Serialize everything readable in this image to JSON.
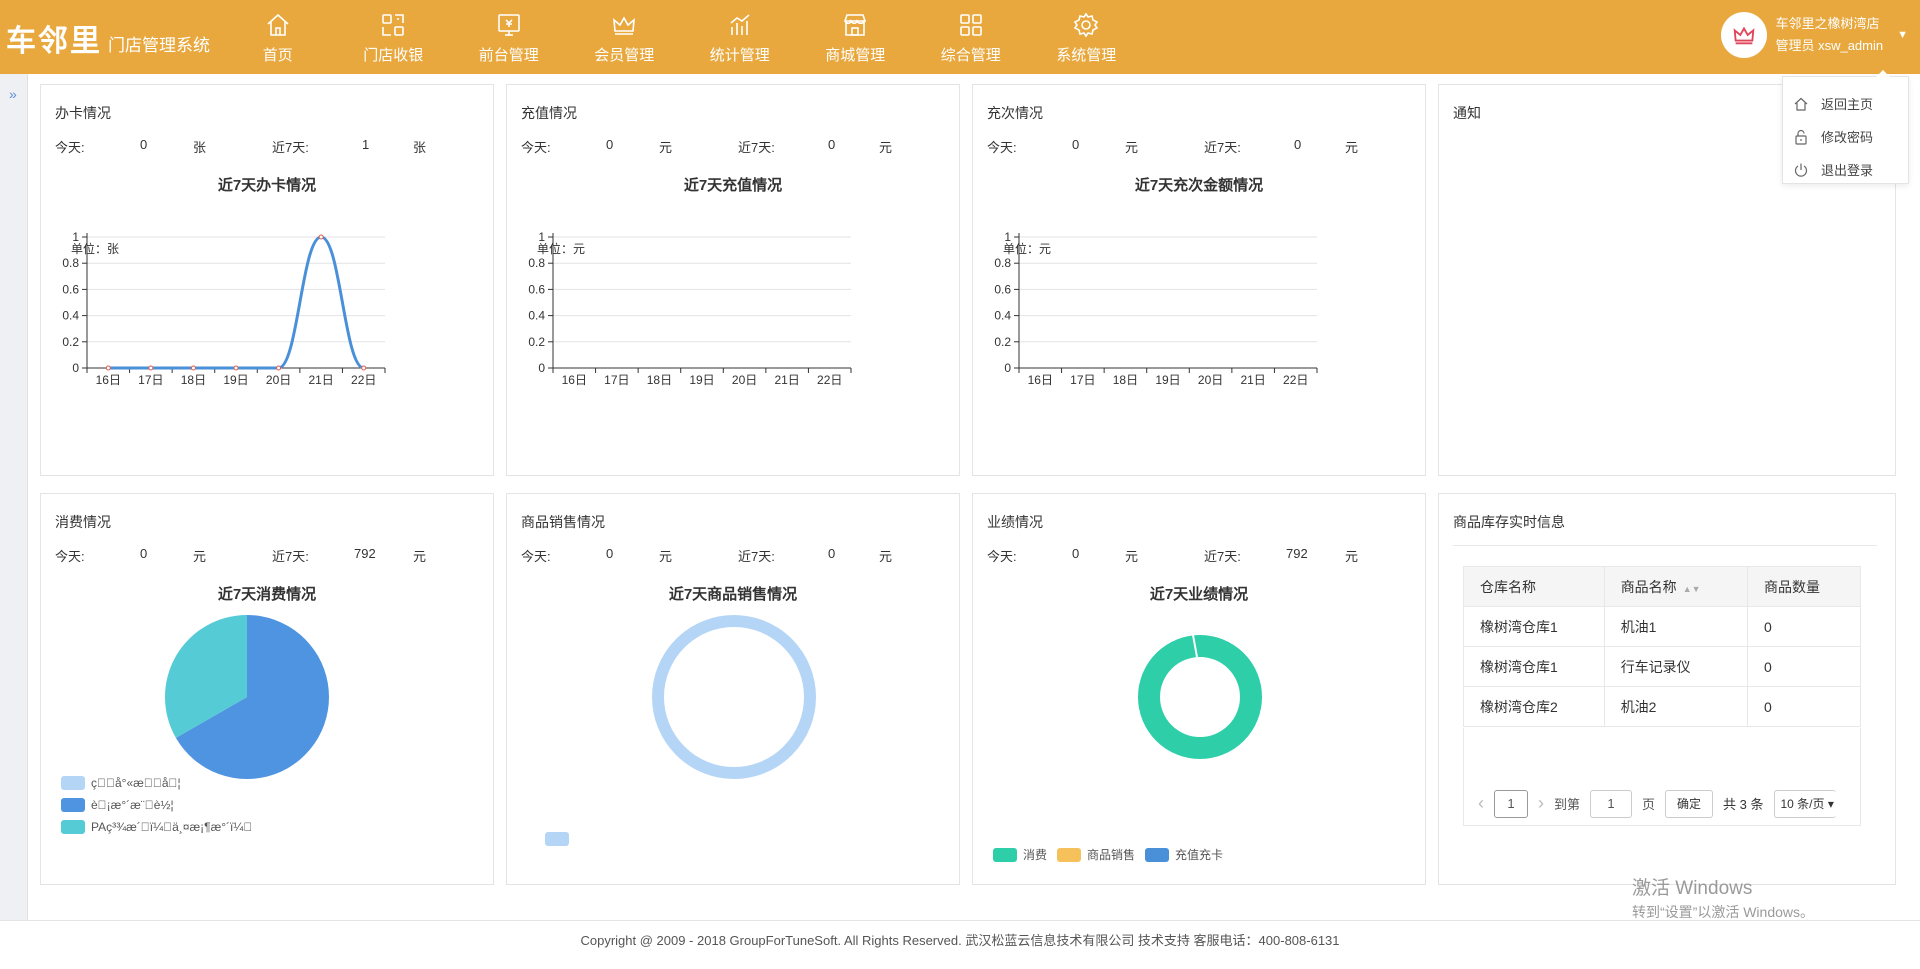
{
  "brand": {
    "name": "车邻里",
    "subtitle": "门店管理系统"
  },
  "nav": [
    {
      "label": "首页",
      "icon": "home-icon"
    },
    {
      "label": "门店收银",
      "icon": "cashier-icon"
    },
    {
      "label": "前台管理",
      "icon": "front-desk-icon"
    },
    {
      "label": "会员管理",
      "icon": "crown-icon"
    },
    {
      "label": "统计管理",
      "icon": "stats-icon"
    },
    {
      "label": "商城管理",
      "icon": "shop-icon"
    },
    {
      "label": "综合管理",
      "icon": "grid-icon"
    },
    {
      "label": "系统管理",
      "icon": "gear-icon"
    }
  ],
  "user": {
    "store": "车邻里之橡树湾店",
    "role": "管理员",
    "account": "xsw_admin"
  },
  "dropdown": [
    {
      "label": "返回主页",
      "icon": "home-icon"
    },
    {
      "label": "修改密码",
      "icon": "lock-icon"
    },
    {
      "label": "退出登录",
      "icon": "power-icon"
    }
  ],
  "colors": {
    "header": "#e8a83e",
    "line": "#4a90d9",
    "pie_blue": "#4f94e0",
    "pie_cyan": "#55cbd6",
    "ring_light": "#b5d5f7",
    "ring_green": "#2ecfa8",
    "legend_orange": "#f6c15b"
  },
  "cards": {
    "card": {
      "title": "办卡情况",
      "today_label": "今天:",
      "today_value": "0",
      "today_unit": "张",
      "week_label": "近7天:",
      "week_value": "1",
      "week_unit": "张",
      "chart_title": "近7天办卡情况",
      "unit_label": "单位：张"
    },
    "recharge": {
      "title": "充值情况",
      "today_label": "今天:",
      "today_value": "0",
      "today_unit": "元",
      "week_label": "近7天:",
      "week_value": "0",
      "week_unit": "元",
      "chart_title": "近7天充值情况",
      "unit_label": "单位：元"
    },
    "times": {
      "title": "充次情况",
      "today_label": "今天:",
      "today_value": "0",
      "today_unit": "元",
      "week_label": "近7天:",
      "week_value": "0",
      "week_unit": "元",
      "chart_title": "近7天充次金额情况",
      "unit_label": "单位：元"
    },
    "notice": {
      "title": "通知"
    },
    "consume": {
      "title": "消费情况",
      "today_label": "今天:",
      "today_value": "0",
      "today_unit": "元",
      "week_label": "近7天:",
      "week_value": "792",
      "week_unit": "元",
      "chart_title": "近7天消费情况"
    },
    "sales": {
      "title": "商品销售情况",
      "today_label": "今天:",
      "today_value": "0",
      "today_unit": "元",
      "week_label": "近7天:",
      "week_value": "0",
      "week_unit": "元",
      "chart_title": "近7天商品销售情况"
    },
    "perf": {
      "title": "业绩情况",
      "today_label": "今天:",
      "today_value": "0",
      "today_unit": "元",
      "week_label": "近7天:",
      "week_value": "792",
      "week_unit": "元",
      "chart_title": "近7天业绩情况"
    },
    "stock": {
      "title": "商品库存实时信息"
    }
  },
  "chart_data": [
    {
      "type": "line",
      "id": "card-line",
      "x": [
        "16日",
        "17日",
        "18日",
        "19日",
        "20日",
        "21日",
        "22日"
      ],
      "series": [
        {
          "values": [
            0,
            0,
            0,
            0,
            0,
            1,
            0
          ]
        }
      ],
      "yticks": [
        "0",
        "0.2",
        "0.4",
        "0.6",
        "0.8",
        "1"
      ],
      "ylim": [
        0,
        1
      ],
      "smooth": true
    },
    {
      "type": "line",
      "id": "recharge-line",
      "x": [
        "16日",
        "17日",
        "18日",
        "19日",
        "20日",
        "21日",
        "22日"
      ],
      "series": [],
      "yticks": [
        "0",
        "0.2",
        "0.4",
        "0.6",
        "0.8",
        "1"
      ],
      "ylim": [
        0,
        1
      ]
    },
    {
      "type": "line",
      "id": "times-line",
      "x": [
        "16日",
        "17日",
        "18日",
        "19日",
        "20日",
        "21日",
        "22日"
      ],
      "series": [],
      "yticks": [
        "0",
        "0.2",
        "0.4",
        "0.6",
        "0.8",
        "1"
      ],
      "ylim": [
        0,
        1
      ]
    },
    {
      "type": "pie",
      "id": "consume-pie",
      "slices": [
        {
          "label": "ç\u0000\u0000å°«æ\u0000\u0000å\u0000¦",
          "value": 0,
          "color": "#b5d5f7"
        },
        {
          "label": "è\u0000¡æ°´æ¨\u0000è½¦",
          "value": 0.667,
          "color": "#4f94e0"
        },
        {
          "label": "PAç³¾æ´\u0000ï¼\u0000ä¸¤æ¡¶æ°´ï¼\u0000",
          "value": 0.333,
          "color": "#55cbd6"
        }
      ]
    },
    {
      "type": "pie",
      "id": "sales-ring",
      "slices": [
        {
          "label": "",
          "value": 1,
          "color": "#b5d5f7"
        }
      ]
    },
    {
      "type": "pie",
      "id": "perf-ring",
      "slices": [
        {
          "label": "消费",
          "value": 1,
          "color": "#2ecfa8"
        },
        {
          "label": "商品销售",
          "value": 0,
          "color": "#f6c15b"
        },
        {
          "label": "充值充卡",
          "value": 0,
          "color": "#4a90d9"
        }
      ]
    }
  ],
  "stock_table": {
    "columns": [
      "仓库名称",
      "商品名称",
      "商品数量"
    ],
    "rows": [
      [
        "橡树湾仓库1",
        "机油1",
        "0"
      ],
      [
        "橡树湾仓库1",
        "行车记录仪",
        "0"
      ],
      [
        "橡树湾仓库2",
        "机油2",
        "0"
      ]
    ],
    "pager": {
      "page": "1",
      "goto_label": "到第",
      "goto_value": "1",
      "page_label": "页",
      "confirm": "确定",
      "total": "共 3 条",
      "page_size": "10 条/页"
    }
  },
  "footer": "Copyright @ 2009 - 2018 GroupForTuneSoft. All Rights Reserved. 武汉松蓝云信息技术有限公司 技术支持 客服电话：400-808-6131",
  "watermark": {
    "line1": "激活 Windows",
    "line2": "转到“设置”以激活 Windows。"
  }
}
